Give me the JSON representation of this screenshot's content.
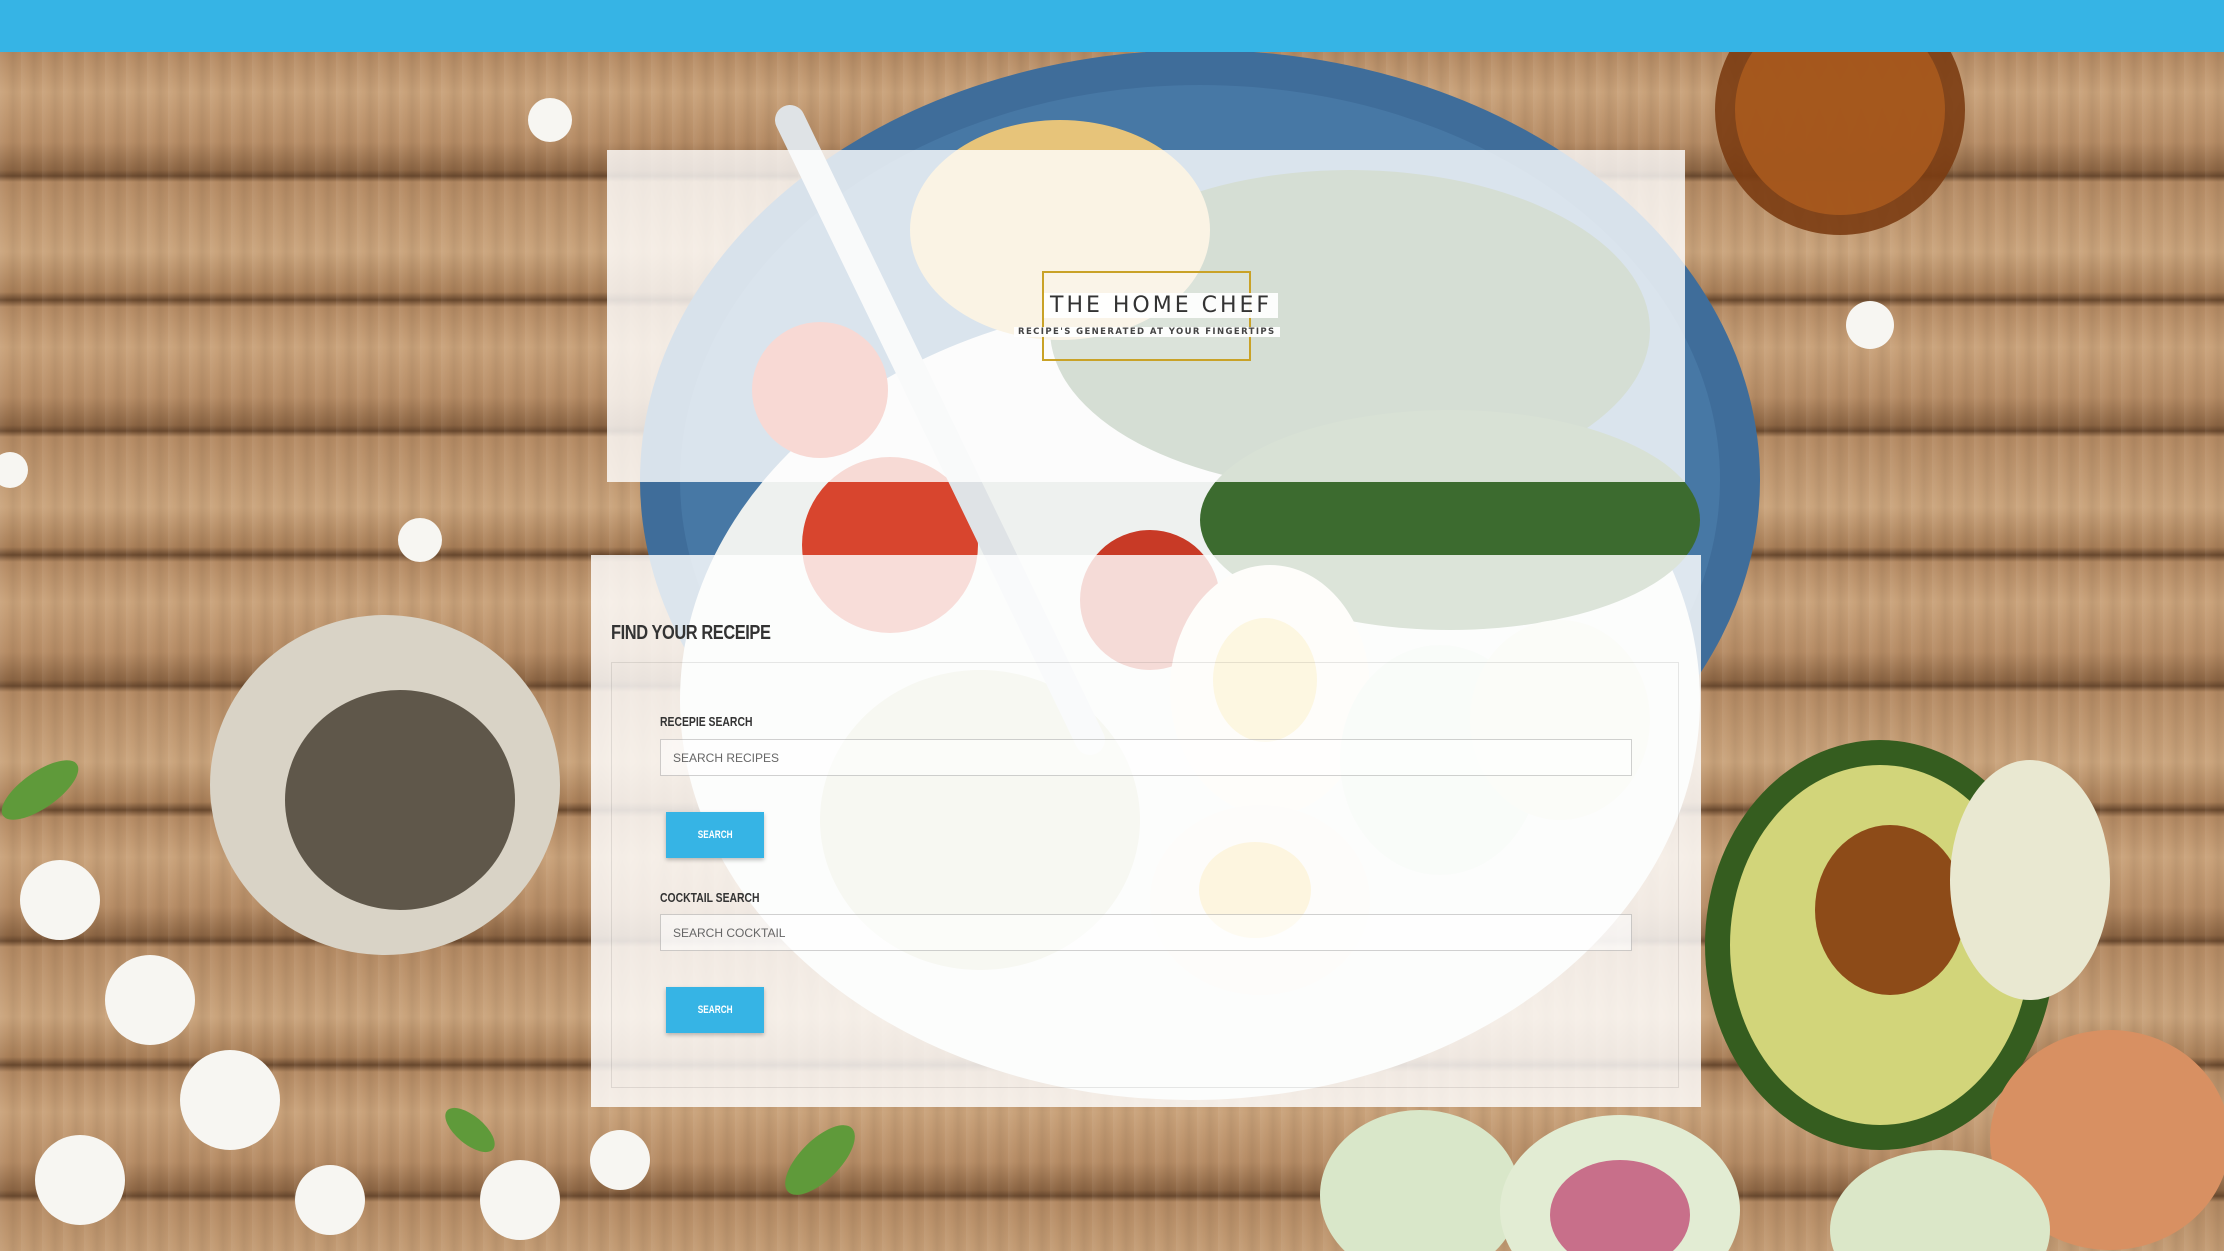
{
  "header": {
    "bar_color": "#36b4e5"
  },
  "logo": {
    "title": "THE HOME CHEF",
    "tagline": "RECIPE'S GENERATED AT YOUR FINGERTIPS",
    "border_color": "#c9a227"
  },
  "search_panel": {
    "title": "Find Your Receipe",
    "recipe": {
      "label": "Recepie Search",
      "placeholder": "Search Recipes",
      "value": "",
      "button_label": "Search"
    },
    "cocktail": {
      "label": "Cocktail Search",
      "placeholder": "Search Cocktail",
      "value": "",
      "button_label": "Search"
    },
    "accent_color": "#36b4e5"
  },
  "background": {
    "description_icon": "food-table-photo"
  }
}
